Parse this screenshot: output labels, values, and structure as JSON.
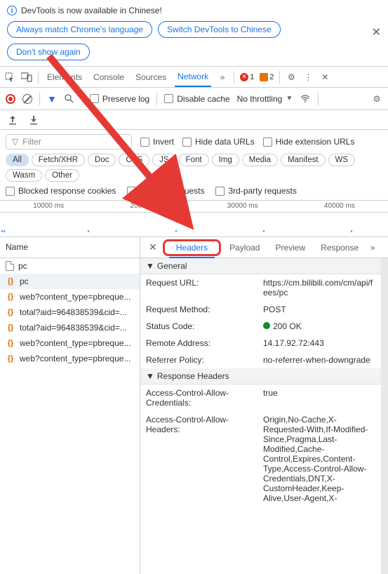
{
  "banner": {
    "title": "DevTools is now available in Chinese!",
    "match_btn": "Always match Chrome's language",
    "switch_btn": "Switch DevTools to Chinese",
    "dont_show": "Don't show again"
  },
  "main_tabs": {
    "elements": "Elements",
    "console": "Console",
    "sources": "Sources",
    "network": "Network",
    "errors": "1",
    "warnings": "2"
  },
  "net_toolbar": {
    "preserve": "Preserve log",
    "disable_cache": "Disable cache",
    "throttling": "No throttling"
  },
  "filter": {
    "placeholder": "Filter",
    "invert": "Invert",
    "hide_data": "Hide data URLs",
    "hide_ext": "Hide extension URLs",
    "chips": [
      "All",
      "Fetch/XHR",
      "Doc",
      "CSS",
      "JS",
      "Font",
      "Img",
      "Media",
      "Manifest",
      "WS",
      "Wasm",
      "Other"
    ],
    "blocked_cookies": "Blocked response cookies",
    "blocked_req": "Blocked requests",
    "third_party": "3rd-party requests"
  },
  "timeline": [
    "10000 ms",
    "20000 ms",
    "30000 ms",
    "40000 ms"
  ],
  "name_col": {
    "header": "Name",
    "rows": [
      {
        "icon": "doc",
        "text": "pc"
      },
      {
        "icon": "json",
        "text": "pc",
        "selected": true
      },
      {
        "icon": "json",
        "text": "web?content_type=pbreque..."
      },
      {
        "icon": "json",
        "text": "total?aid=964838539&cid=..."
      },
      {
        "icon": "json",
        "text": "total?aid=964838539&cid=..."
      },
      {
        "icon": "json",
        "text": "web?content_type=pbreque..."
      },
      {
        "icon": "json",
        "text": "web?content_type=pbreque..."
      }
    ]
  },
  "detail_tabs": {
    "headers": "Headers",
    "payload": "Payload",
    "preview": "Preview",
    "response": "Response"
  },
  "general": {
    "title": "General",
    "request_url_k": "Request URL:",
    "request_url_v": "https://cm.bilibili.com/cm/api/fees/pc",
    "method_k": "Request Method:",
    "method_v": "POST",
    "status_k": "Status Code:",
    "status_v": "200 OK",
    "remote_k": "Remote Address:",
    "remote_v": "14.17.92.72:443",
    "referrer_k": "Referrer Policy:",
    "referrer_v": "no-referrer-when-downgrade"
  },
  "response_headers": {
    "title": "Response Headers",
    "acac_k": "Access-Control-Allow-Credentials:",
    "acac_v": "true",
    "acah_k": "Access-Control-Allow-Headers:",
    "acah_v": "Origin,No-Cache,X-Requested-With,If-Modified-Since,Pragma,Last-Modified,Cache-Control,Expires,Content-Type,Access-Control-Allow-Credentials,DNT,X-CustomHeader,Keep-Alive,User-Agent,X-"
  }
}
